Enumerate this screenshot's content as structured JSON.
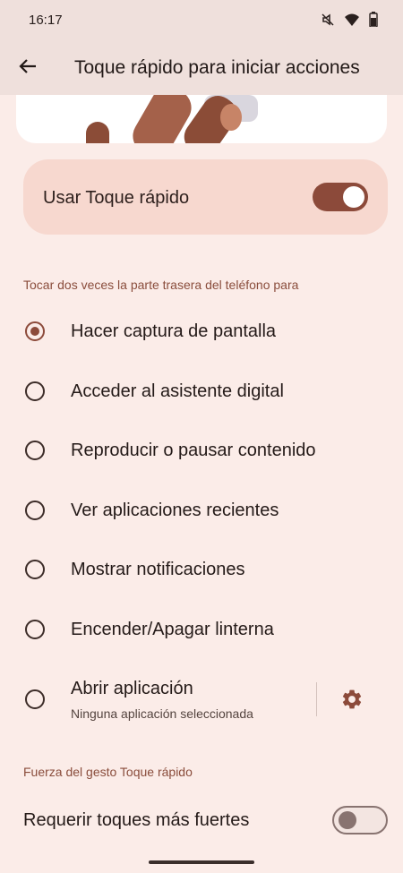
{
  "status_bar": {
    "time": "16:17",
    "icons": [
      "mute-icon",
      "wifi-icon",
      "battery-icon"
    ]
  },
  "top_bar": {
    "back_icon": "arrow-back-icon",
    "title": "Toque rápido para iniciar acciones"
  },
  "main_toggle": {
    "label": "Usar Toque rápido",
    "enabled": true
  },
  "double_tap_section": {
    "header": "Tocar dos veces la parte trasera del teléfono para",
    "options": [
      {
        "label": "Hacer captura de pantalla",
        "selected": true
      },
      {
        "label": "Acceder al asistente digital",
        "selected": false
      },
      {
        "label": "Reproducir o pausar contenido",
        "selected": false
      },
      {
        "label": "Ver aplicaciones recientes",
        "selected": false
      },
      {
        "label": "Mostrar notificaciones",
        "selected": false
      },
      {
        "label": "Encender/Apagar linterna",
        "selected": false
      },
      {
        "label": "Abrir aplicación",
        "sublabel": "Ninguna aplicación seleccionada",
        "selected": false,
        "settings_icon": "gear-icon"
      }
    ]
  },
  "gesture_strength_section": {
    "header": "Fuerza del gesto Toque rápido",
    "require_stronger_taps": {
      "label": "Requerir toques más fuertes",
      "enabled": false
    }
  },
  "colors": {
    "background": "#fbece8",
    "accent": "#8c4a3a",
    "card": "#f7d8cf",
    "section_header": "#8a4d3c"
  }
}
